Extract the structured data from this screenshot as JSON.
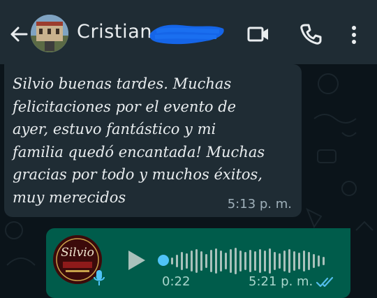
{
  "header": {
    "contact_name": "Cristian",
    "icons": [
      "back-arrow-icon",
      "contact-avatar",
      "video-call-icon",
      "voice-call-icon",
      "overflow-menu-icon"
    ]
  },
  "incoming_message": {
    "text": "Silvio buenas tardes. Muchas\nfelicitaciones por el evento de\nayer, estuvo fantástico y mi\nfamilia quedó encantada! Muchas\ngracias por todo y muchos éxitos,\nmuy merecidos",
    "time": "5:13 p. m."
  },
  "outgoing_voice_message": {
    "avatar_logo_text": "Silvio",
    "duration": "0:22",
    "time": "5:21 p. m.",
    "status": "read",
    "progress": 0.0
  },
  "colors": {
    "background": "#0b141a",
    "header": "#1f2c34",
    "incoming_bubble": "#1f2c34",
    "outgoing_bubble": "#005c4b",
    "accent_blue": "#4fc3f7"
  }
}
